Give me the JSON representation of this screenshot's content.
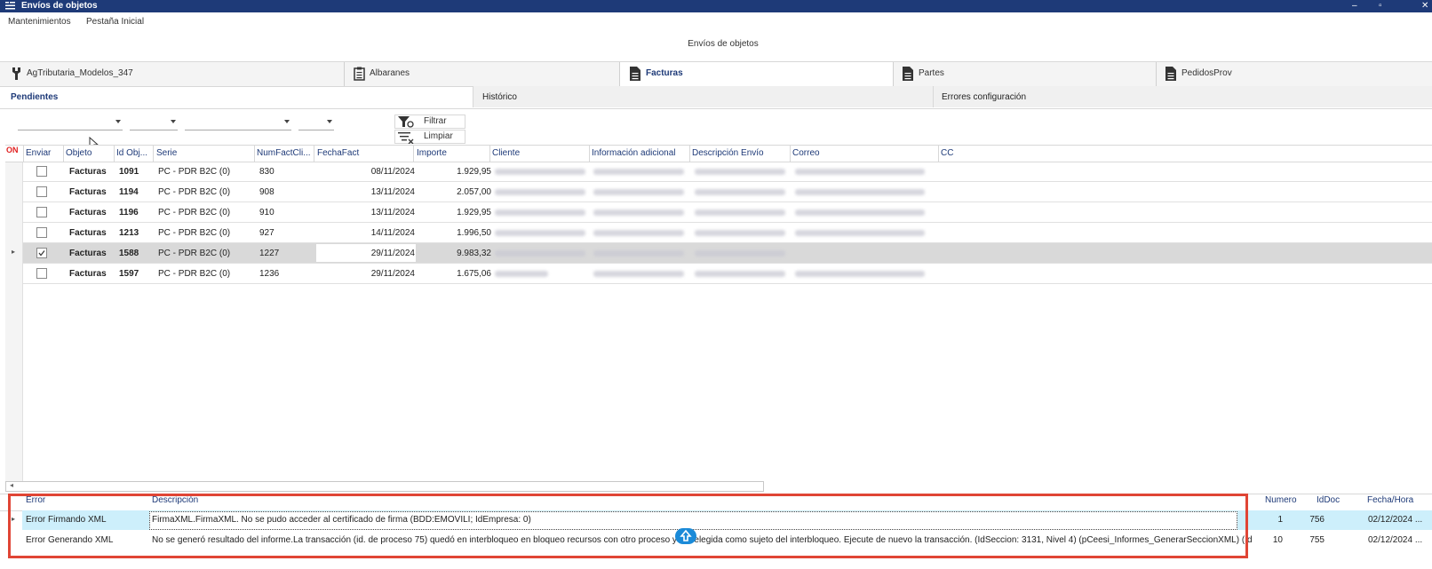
{
  "window": {
    "title": "Envíos de objetos",
    "minimize": "–",
    "restore": "▫",
    "close": "✕"
  },
  "menu": {
    "items": [
      "Mantenimientos",
      "Pestaña Inicial"
    ]
  },
  "page_caption": "Envíos de objetos",
  "main_tabs": [
    {
      "label": "AgTributaria_Modelos_347",
      "icon": "wrench-icon"
    },
    {
      "label": "Albaranes",
      "icon": "clipboard-icon"
    },
    {
      "label": "Facturas",
      "icon": "document-icon",
      "active": true
    },
    {
      "label": "Partes",
      "icon": "document-icon"
    },
    {
      "label": "PedidosProv",
      "icon": "document-icon"
    }
  ],
  "sub_tabs": [
    {
      "label": "Pendientes",
      "active": true
    },
    {
      "label": "Histórico"
    },
    {
      "label": "Errores configuración"
    }
  ],
  "filters": {
    "filter_button": "Filtrar",
    "clear_button": "Limpiar"
  },
  "grid": {
    "on_label": "ON",
    "columns": [
      "Enviar",
      "Objeto",
      "Id Obj...",
      "Serie",
      "NumFactCli...",
      "FechaFact",
      "Importe",
      "Cliente",
      "Información adicional",
      "Descripción Envío",
      "Correo",
      "CC"
    ],
    "rows": [
      {
        "checked": false,
        "objeto": "Facturas",
        "id": "1091",
        "serie": "PC - PDR B2C (0)",
        "num": "830",
        "fecha": "08/11/2024",
        "importe": "1.929,95"
      },
      {
        "checked": false,
        "objeto": "Facturas",
        "id": "1194",
        "serie": "PC - PDR B2C (0)",
        "num": "908",
        "fecha": "13/11/2024",
        "importe": "2.057,00"
      },
      {
        "checked": false,
        "objeto": "Facturas",
        "id": "1196",
        "serie": "PC - PDR B2C (0)",
        "num": "910",
        "fecha": "13/11/2024",
        "importe": "1.929,95"
      },
      {
        "checked": false,
        "objeto": "Facturas",
        "id": "1213",
        "serie": "PC - PDR B2C (0)",
        "num": "927",
        "fecha": "14/11/2024",
        "importe": "1.996,50"
      },
      {
        "checked": true,
        "objeto": "Facturas",
        "id": "1588",
        "serie": "PC - PDR B2C (0)",
        "num": "1227",
        "fecha": "29/11/2024",
        "importe": "9.983,32",
        "selected": true
      },
      {
        "checked": false,
        "objeto": "Facturas",
        "id": "1597",
        "serie": "PC - PDR B2C (0)",
        "num": "1236",
        "fecha": "29/11/2024",
        "importe": "1.675,06"
      }
    ]
  },
  "errors": {
    "columns": [
      "Error",
      "Descripción",
      "Numero",
      "IdDoc",
      "Fecha/Hora"
    ],
    "rows": [
      {
        "error": "Error Firmando XML",
        "descripcion": "FirmaXML.FirmaXML. No se pudo acceder al certificado de firma (BDD:EMOVILI; IdEmpresa: 0)",
        "numero": "1",
        "iddoc": "756",
        "fecha": "02/12/2024 ..."
      },
      {
        "error": "Error Generando XML",
        "descripcion": "No se generó resultado del informe.La transacción (id. de proceso 75) quedó en interbloqueo en bloqueo recursos con otro proceso y fue elegida como sujeto del interbloqueo. Ejecute de nuevo la transacción. (IdSeccion: 3131, Nivel 4) (pCeesi_Informes_GenerarSeccionXML) (IdSec...",
        "numero": "10",
        "iddoc": "755",
        "fecha": "02/12/2024 ..."
      }
    ]
  },
  "colors": {
    "titlebar": "#1e3a78",
    "accent": "#1e3a78",
    "highlight_row": "#cdeffb",
    "error_border": "#e04535",
    "on_label": "#e02020",
    "scroll_up_button": "#1a8ad8"
  }
}
